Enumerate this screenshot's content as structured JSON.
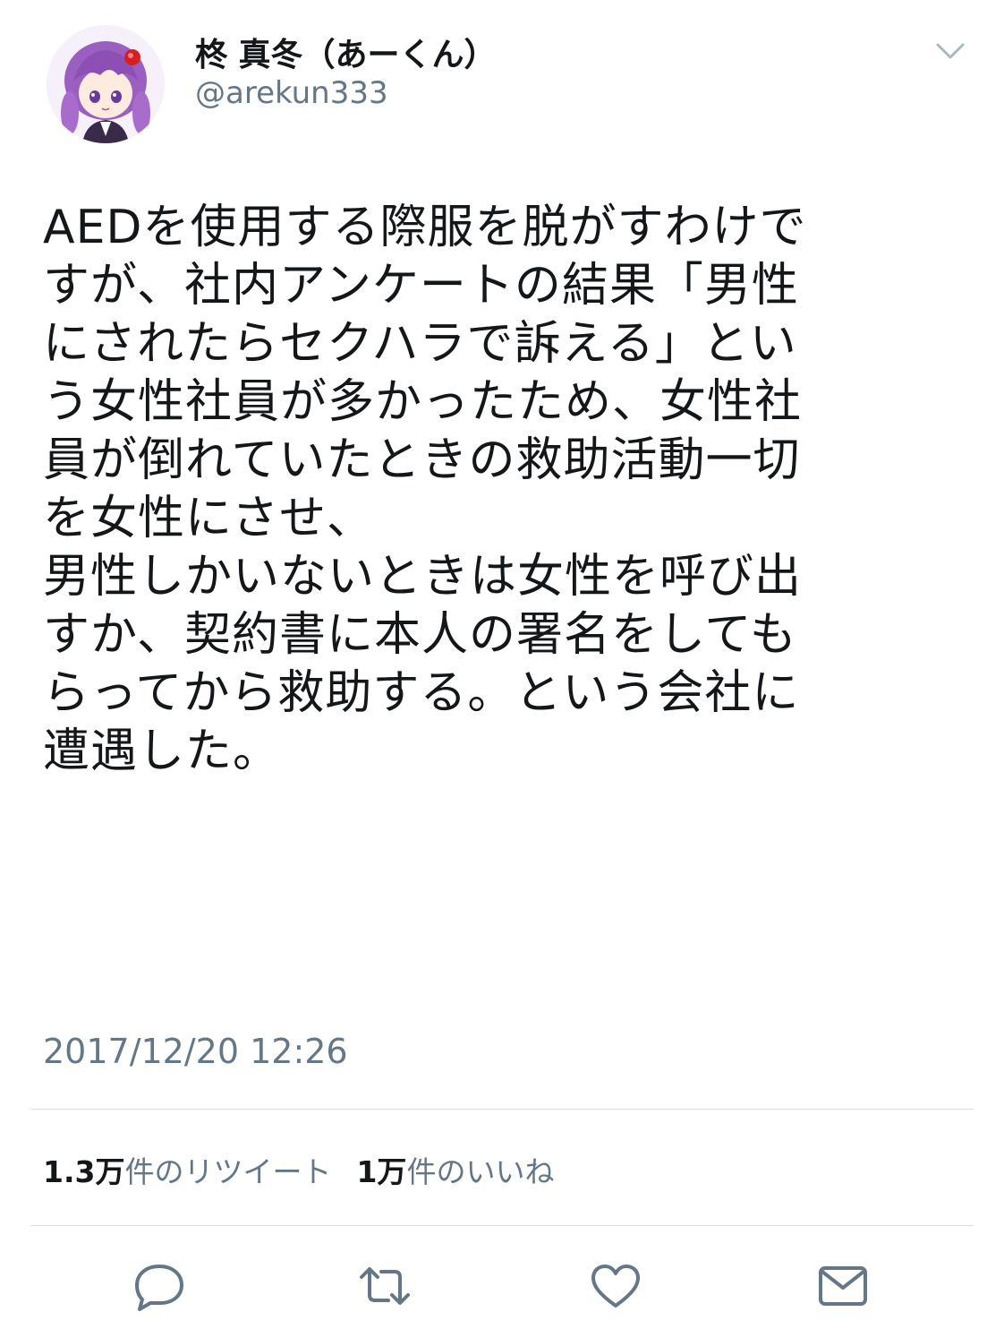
{
  "user": {
    "display_name": "柊 真冬（あーくん）",
    "handle": "@arekun333",
    "avatar_icon": "anime-avatar-icon"
  },
  "tweet": {
    "text": "AEDを使用する際服を脱がすわけで\nすが、社内アンケートの結果「男性\nにされたらセクハラで訴える」とい\nう女性社員が多かったため、女性社\n員が倒れていたときの救助活動一切\nを女性にさせ、\n男性しかいないときは女性を呼び出\nすか、契約書に本人の署名をしても\nらってから救助する。という会社に\n遭遇した。",
    "timestamp": "2017/12/20 12:26"
  },
  "stats": {
    "retweet_count": "1.3万",
    "retweet_label": "件のリツイート",
    "like_count": "1万",
    "like_label": "件のいいね"
  },
  "actions": {
    "reply_icon": "reply-icon",
    "retweet_icon": "retweet-icon",
    "like_icon": "heart-icon",
    "dm_icon": "envelope-icon"
  },
  "colors": {
    "text_primary": "#14171a",
    "text_secondary": "#657786",
    "icon_gray": "#657786",
    "divider": "#d9dee2",
    "avatar_hair": "#9b5fc0"
  }
}
